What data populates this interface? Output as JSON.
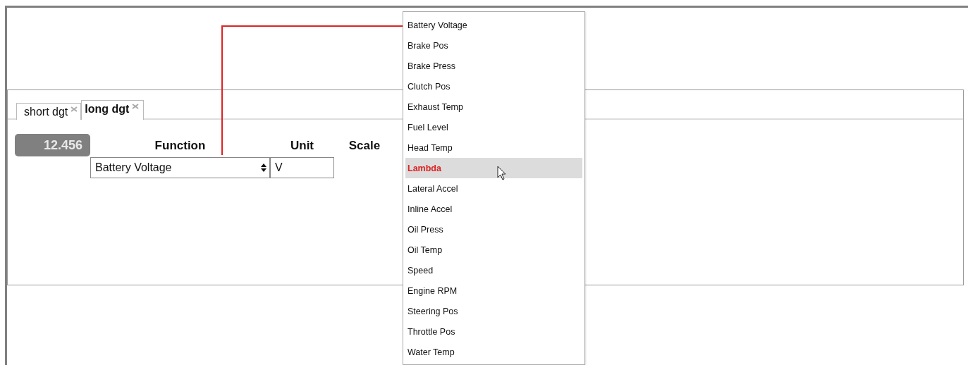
{
  "tabs": [
    {
      "label": "short dgt",
      "selected": false
    },
    {
      "label": "long dgt",
      "selected": true
    }
  ],
  "gauge": {
    "value": "12.456"
  },
  "columns": [
    "Function",
    "Unit",
    "Scale"
  ],
  "function_select": {
    "value": "Battery Voltage"
  },
  "unit_field": {
    "value": "V"
  },
  "dropdown": {
    "items": [
      {
        "label": "Battery Voltage",
        "selected": false
      },
      {
        "label": "Brake Pos",
        "selected": false
      },
      {
        "label": "Brake Press",
        "selected": false
      },
      {
        "label": "Clutch Pos",
        "selected": false
      },
      {
        "label": "Exhaust Temp",
        "selected": false
      },
      {
        "label": "Fuel Level",
        "selected": false
      },
      {
        "label": "Head Temp",
        "selected": false
      },
      {
        "label": "Lambda",
        "selected": true
      },
      {
        "label": "Lateral Accel",
        "selected": false
      },
      {
        "label": "Inline Accel",
        "selected": false
      },
      {
        "label": "Oil Press",
        "selected": false
      },
      {
        "label": "Oil Temp",
        "selected": false
      },
      {
        "label": "Speed",
        "selected": false
      },
      {
        "label": "Engine RPM",
        "selected": false
      },
      {
        "label": "Steering Pos",
        "selected": false
      },
      {
        "label": "Throttle Pos",
        "selected": false
      },
      {
        "label": "Water Temp",
        "selected": false
      }
    ]
  }
}
